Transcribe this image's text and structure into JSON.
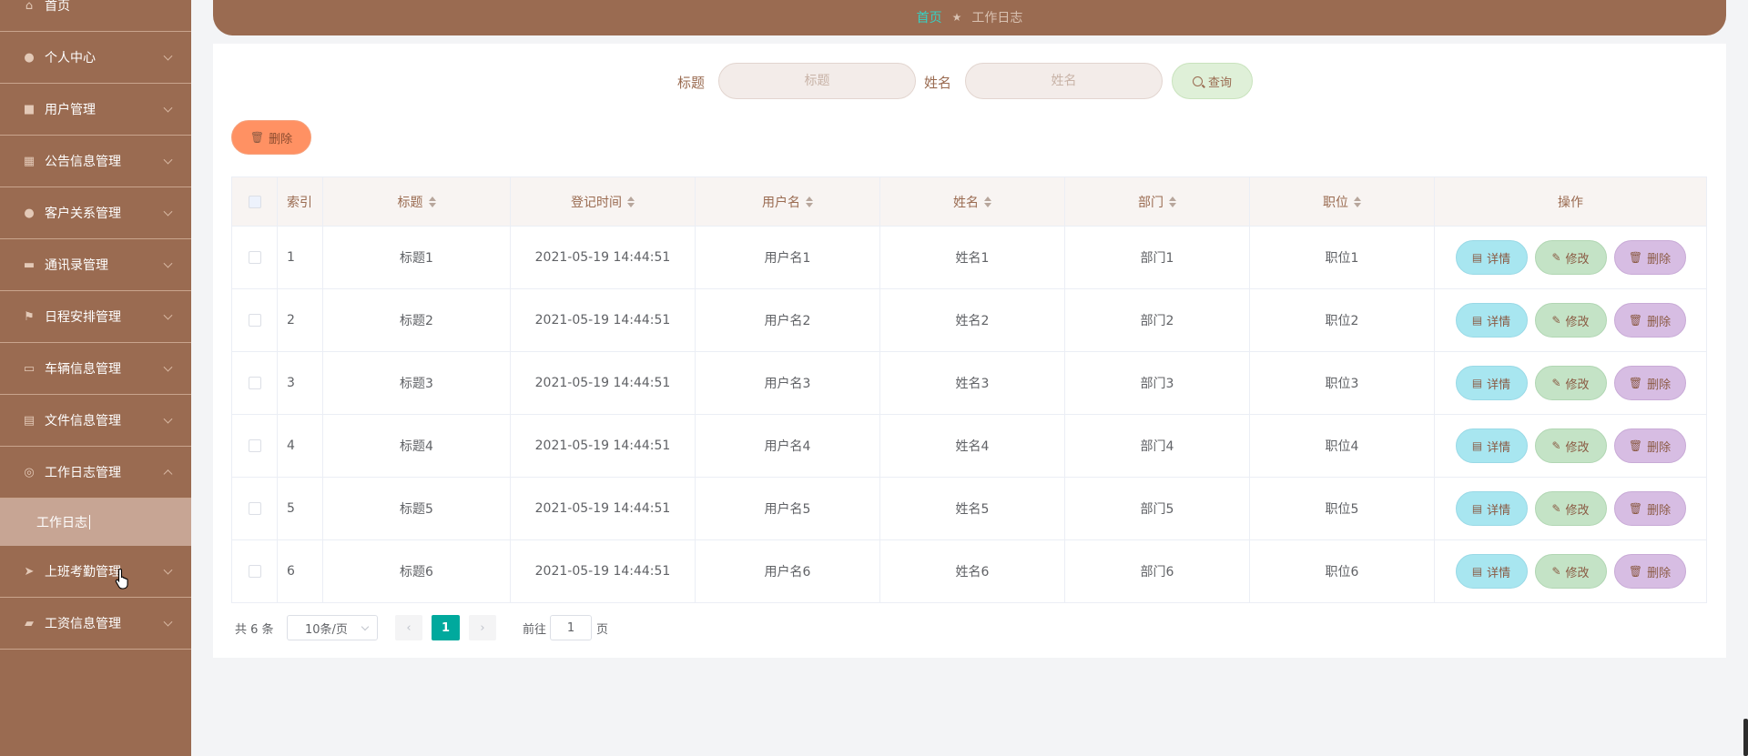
{
  "sidebar": {
    "items": [
      {
        "label": "首页",
        "icon": "home-icon",
        "expandable": false
      },
      {
        "label": "个人中心",
        "icon": "user-icon",
        "expandable": true
      },
      {
        "label": "用户管理",
        "icon": "users-icon",
        "expandable": true
      },
      {
        "label": "公告信息管理",
        "icon": "grid-icon",
        "expandable": true
      },
      {
        "label": "客户关系管理",
        "icon": "contact-icon",
        "expandable": true
      },
      {
        "label": "通讯录管理",
        "icon": "briefcase-icon",
        "expandable": true
      },
      {
        "label": "日程安排管理",
        "icon": "flag-icon",
        "expandable": true
      },
      {
        "label": "车辆信息管理",
        "icon": "message-icon",
        "expandable": true
      },
      {
        "label": "文件信息管理",
        "icon": "document-icon",
        "expandable": true
      },
      {
        "label": "工作日志管理",
        "icon": "compass-icon",
        "expandable": true,
        "expanded": true
      },
      {
        "label": "上班考勤管理",
        "icon": "send-icon",
        "expandable": true
      },
      {
        "label": "工资信息管理",
        "icon": "ticket-icon",
        "expandable": true
      }
    ],
    "subitem": {
      "label": "工作日志"
    }
  },
  "breadcrumb": {
    "home": "首页",
    "separator": "★",
    "current": "工作日志"
  },
  "search": {
    "title_label": "标题",
    "title_placeholder": "标题",
    "name_label": "姓名",
    "name_placeholder": "姓名",
    "button_label": "查询"
  },
  "toolbar": {
    "delete_label": "删除"
  },
  "table": {
    "headers": {
      "index": "索引",
      "title": "标题",
      "time": "登记时间",
      "username": "用户名",
      "name": "姓名",
      "dept": "部门",
      "position": "职位",
      "ops": "操作"
    },
    "rows": [
      {
        "index": "1",
        "title": "标题1",
        "time": "2021-05-19 14:44:51",
        "username": "用户名1",
        "name": "姓名1",
        "dept": "部门1",
        "position": "职位1"
      },
      {
        "index": "2",
        "title": "标题2",
        "time": "2021-05-19 14:44:51",
        "username": "用户名2",
        "name": "姓名2",
        "dept": "部门2",
        "position": "职位2"
      },
      {
        "index": "3",
        "title": "标题3",
        "time": "2021-05-19 14:44:51",
        "username": "用户名3",
        "name": "姓名3",
        "dept": "部门3",
        "position": "职位3"
      },
      {
        "index": "4",
        "title": "标题4",
        "time": "2021-05-19 14:44:51",
        "username": "用户名4",
        "name": "姓名4",
        "dept": "部门4",
        "position": "职位4"
      },
      {
        "index": "5",
        "title": "标题5",
        "time": "2021-05-19 14:44:51",
        "username": "用户名5",
        "name": "姓名5",
        "dept": "部门5",
        "position": "职位5"
      },
      {
        "index": "6",
        "title": "标题6",
        "time": "2021-05-19 14:44:51",
        "username": "用户名6",
        "name": "姓名6",
        "dept": "部门6",
        "position": "职位6"
      }
    ],
    "op_labels": {
      "detail": "详情",
      "edit": "修改",
      "delete": "删除"
    }
  },
  "pagination": {
    "total": "共 6 条",
    "page_size": "10条/页",
    "current_page": "1",
    "goto_label": "前往",
    "goto_value": "1",
    "goto_unit": "页"
  },
  "colors": {
    "sidebar_bg": "#9a6b51",
    "accent": "#00a99d",
    "detail_btn": "#a8e6f0",
    "edit_btn": "#c4e3c6",
    "delete_btn": "#d7bde3",
    "bulk_delete": "#ff9163"
  }
}
